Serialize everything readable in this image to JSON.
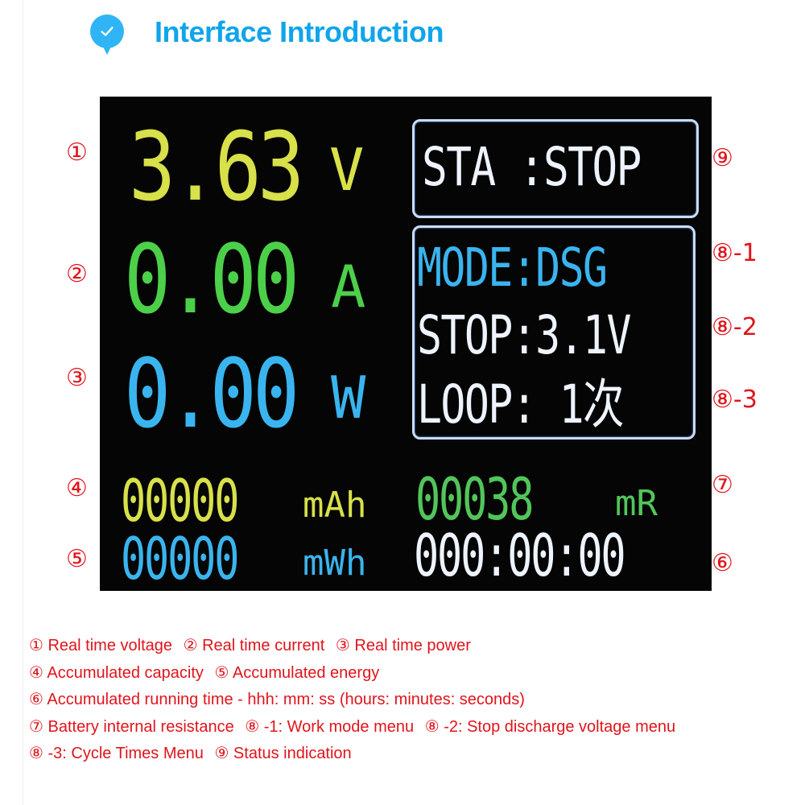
{
  "header": {
    "icon": "check-badge-icon",
    "title": "Interface Introduction",
    "accent_color": "#10a5ea"
  },
  "screen": {
    "voltage": {
      "value": "3.63",
      "unit": "V"
    },
    "current": {
      "value": "0.00",
      "unit": "A"
    },
    "power": {
      "value": "0.00",
      "unit": "W"
    },
    "status": {
      "text": "STA :STOP"
    },
    "menu": {
      "mode": "MODE:DSG",
      "stop": "STOP:3.1V",
      "loop": "LOOP: 1次"
    },
    "capacity": {
      "value": "00000",
      "unit": "mAh"
    },
    "resistance": {
      "value": "00038",
      "unit": "mR"
    },
    "energy": {
      "value": "00000",
      "unit": "mWh"
    },
    "runtime": {
      "value": "000:00:00"
    }
  },
  "callouts": {
    "c1": "①",
    "c2": "②",
    "c3": "③",
    "c4": "④",
    "c5": "⑤",
    "c9": "⑨",
    "c8_1": "⑧-1",
    "c8_2": "⑧-2",
    "c8_3": "⑧-3",
    "c7": "⑦",
    "c6": "⑥"
  },
  "legend": {
    "lines": [
      [
        "① Real time voltage",
        "② Real time current",
        "③ Real time power"
      ],
      [
        "④ Accumulated capacity",
        "⑤ Accumulated energy"
      ],
      [
        "⑥ Accumulated running time - hhh: mm: ss (hours: minutes: seconds)"
      ],
      [
        "⑦ Battery internal resistance",
        "⑧ -1: Work mode menu",
        "⑧ -2: Stop discharge voltage menu"
      ],
      [
        "⑧ -3: Cycle Times Menu",
        "⑨ Status indication"
      ]
    ],
    "color": "#e0141c"
  }
}
